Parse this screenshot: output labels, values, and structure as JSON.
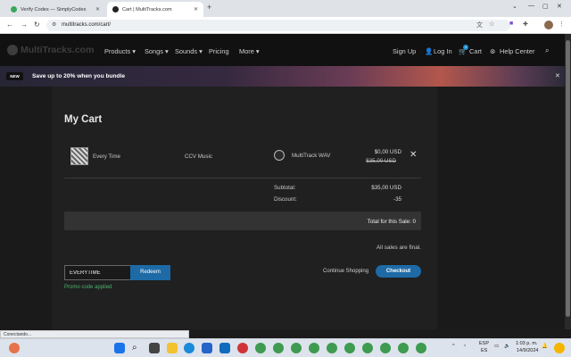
{
  "browser": {
    "tabs": [
      {
        "title": "Verify Codes — SimplyCodes",
        "active": false,
        "favicon_color": "#3aa85a"
      },
      {
        "title": "Cart | MultiTracks.com",
        "active": true,
        "favicon_color": "#222222"
      }
    ],
    "new_tab_glyph": "+",
    "url": "multitracks.com/cart/",
    "window_controls": [
      "⌄",
      "—",
      "▢",
      "✕"
    ]
  },
  "site": {
    "logo_text": "MultiTracks.com",
    "nav": [
      "Products ▾",
      "Songs ▾",
      "Sounds ▾",
      "Pricing",
      "More ▾"
    ],
    "sign_up": "Sign Up",
    "log_in": "Log In",
    "cart_label": "Cart",
    "cart_count": "1",
    "help_center": "Help Center"
  },
  "promo": {
    "badge": "NEW",
    "text": "Save up to 20% when you bundle",
    "close": "✕"
  },
  "cart": {
    "title": "My Cart",
    "item": {
      "song": "Every Time",
      "artist": "CCV Music",
      "format": "MultiTrack WAV",
      "price": "$0,00 USD",
      "original_price": "$35,00 USD"
    },
    "summary": {
      "subtotal_label": "Subtotal:",
      "subtotal_value": "$35,00 USD",
      "discount_label": "Discount:",
      "discount_value": "-35",
      "total_label": "Total for this Sale: 0"
    },
    "all_sales_final": "All sales are final.",
    "coupon_value": "EVERYTIME",
    "redeem": "Redeem",
    "promo_applied": "Promo code applied",
    "continue_shopping": "Continue Shopping",
    "checkout": "Checkout"
  },
  "status_bar": "Conectando...",
  "taskbar": {
    "language": "ESP",
    "region": "ES",
    "time": "1:03 p. m.",
    "date": "14/9/2024"
  },
  "colors": {
    "accent_blue": "#1d6aa6",
    "success_green": "#48b46a",
    "cart_badge": "#1f8fd0"
  }
}
